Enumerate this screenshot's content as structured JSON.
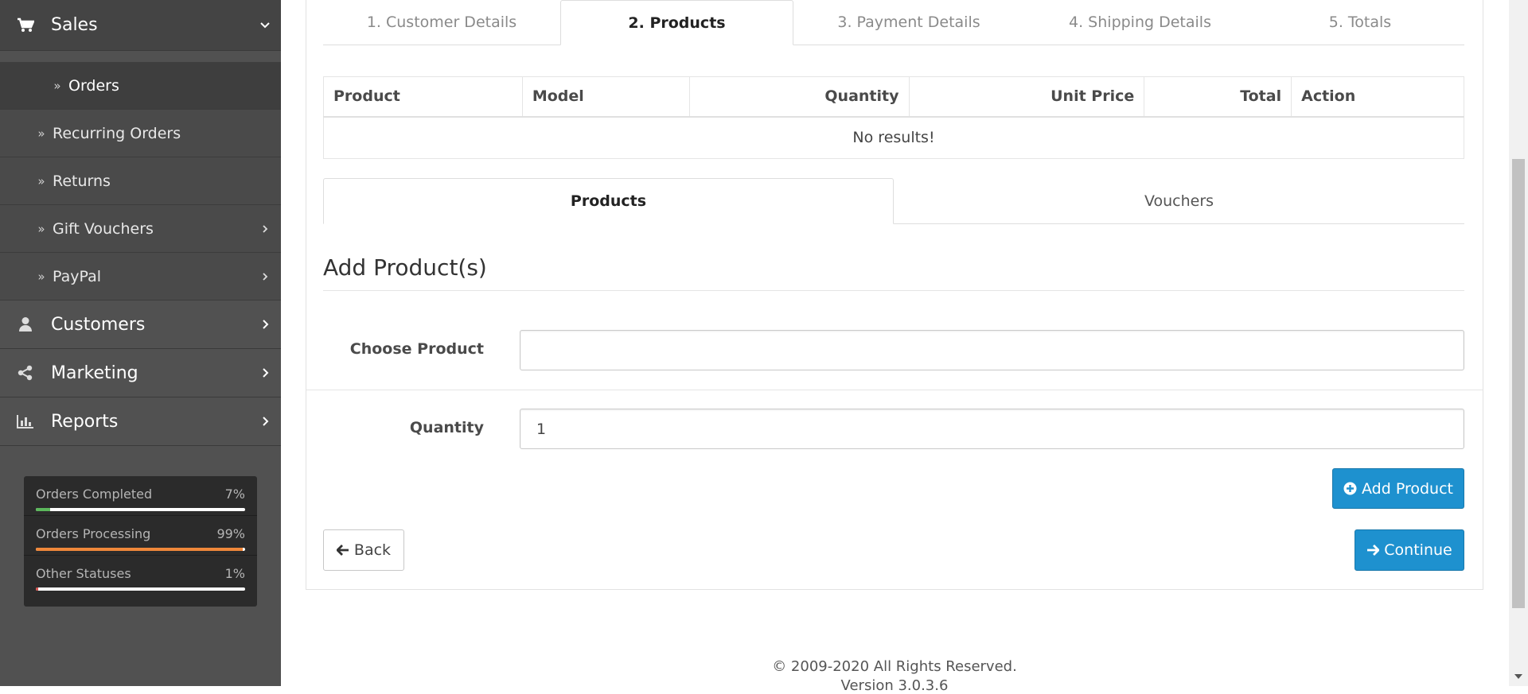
{
  "sidebar": {
    "sales": {
      "label": "Sales",
      "icon": "shopping-cart-icon"
    },
    "sub_items": [
      {
        "label": "Orders"
      },
      {
        "label": "Recurring Orders"
      },
      {
        "label": "Returns"
      },
      {
        "label": "Gift Vouchers"
      },
      {
        "label": "PayPal"
      }
    ],
    "customers": {
      "label": "Customers",
      "icon": "user-icon"
    },
    "marketing": {
      "label": "Marketing",
      "icon": "share-icon"
    },
    "reports": {
      "label": "Reports",
      "icon": "bar-chart-icon"
    }
  },
  "stats": [
    {
      "name": "Orders Completed",
      "value": "7%",
      "level": 0.07,
      "color": "#5cb85c"
    },
    {
      "name": "Orders Processing",
      "value": "99%",
      "level": 0.99,
      "color": "#f0883a"
    },
    {
      "name": "Other Statuses",
      "value": "1%",
      "level": 0.01,
      "color": "#d9534f"
    }
  ],
  "steps": [
    "1. Customer Details",
    "2. Products",
    "3. Payment Details",
    "4. Shipping Details",
    "5. Totals"
  ],
  "table": {
    "headers": [
      "Product",
      "Model",
      "Quantity",
      "Unit Price",
      "Total",
      "Action"
    ],
    "empty": "No results!"
  },
  "subtabs": [
    "Products",
    "Vouchers"
  ],
  "form": {
    "legend": "Add Product(s)",
    "choose_product_label": "Choose Product",
    "choose_product_value": "",
    "quantity_label": "Quantity",
    "quantity_value": "1"
  },
  "buttons": {
    "add_product": "Add Product",
    "back": "Back",
    "continue": "Continue"
  },
  "footer": {
    "copyright": "© 2009-2020 All Rights Reserved.",
    "version": "Version 3.0.3.6"
  },
  "colors": {
    "primary": "#1e91cf",
    "sidebar": "#515151"
  }
}
